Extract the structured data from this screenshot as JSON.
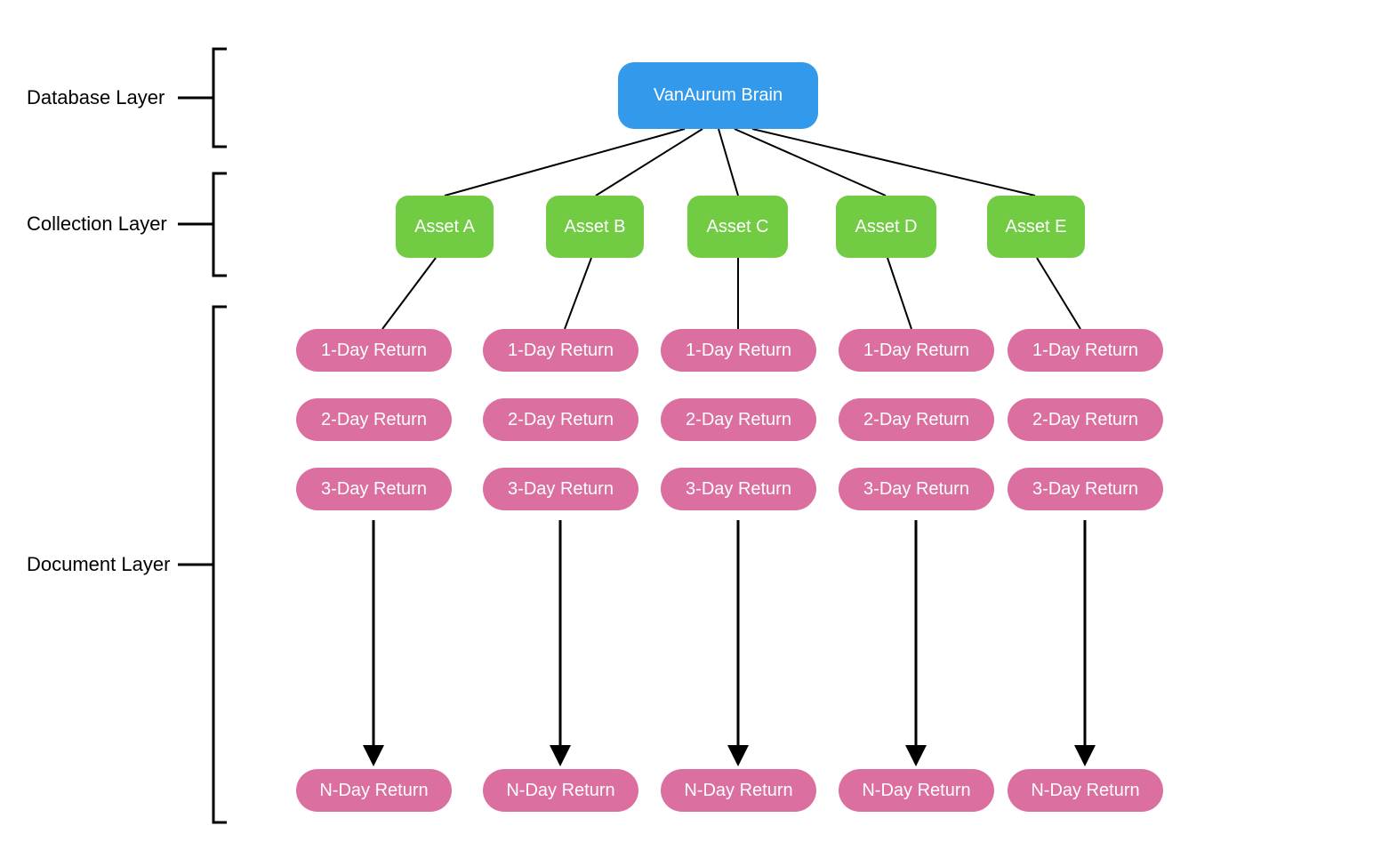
{
  "layers": {
    "database": "Database Layer",
    "collection": "Collection Layer",
    "document": "Document Layer"
  },
  "root": {
    "label": "VanAurum Brain"
  },
  "assets": [
    {
      "label": "Asset A"
    },
    {
      "label": "Asset B"
    },
    {
      "label": "Asset C"
    },
    {
      "label": "Asset D"
    },
    {
      "label": "Asset E"
    }
  ],
  "returns": {
    "r1": "1-Day Return",
    "r2": "2-Day Return",
    "r3": "3-Day Return",
    "rn": "N-Day Return"
  },
  "colors": {
    "blue": "#3399ea",
    "green": "#71cb43",
    "pink": "#db6f9f"
  }
}
